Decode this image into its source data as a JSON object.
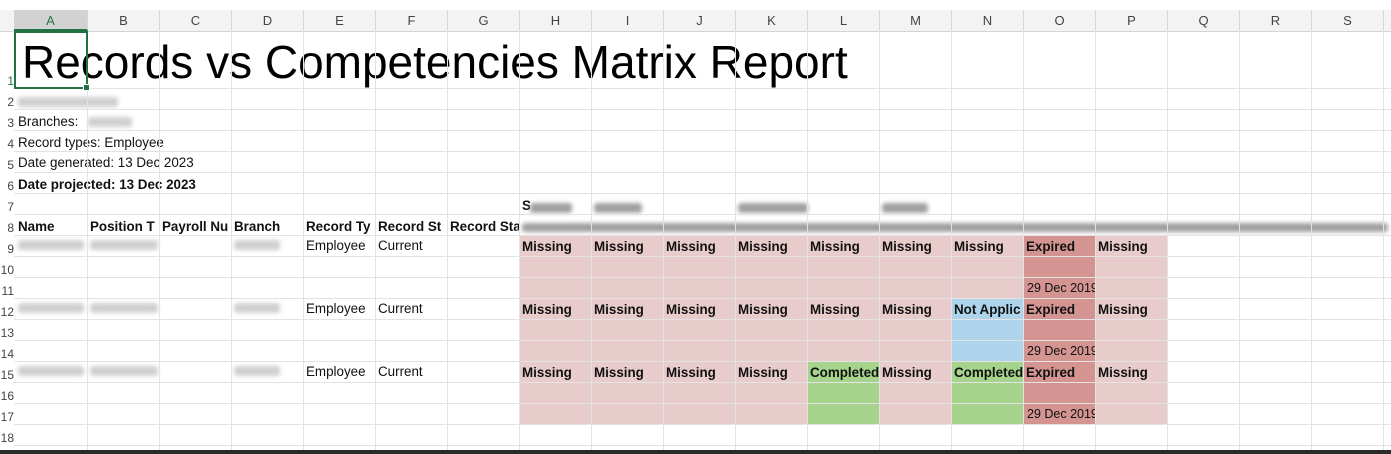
{
  "columns": [
    "A",
    "B",
    "C",
    "D",
    "E",
    "F",
    "G",
    "H",
    "I",
    "J",
    "K",
    "L",
    "M",
    "N",
    "O",
    "P",
    "Q",
    "R",
    "S"
  ],
  "selected_column": "A",
  "rows": [
    "1",
    "2",
    "3",
    "4",
    "5",
    "6",
    "7",
    "8",
    "9",
    "10",
    "11",
    "12",
    "13",
    "14",
    "15",
    "16",
    "17",
    "18"
  ],
  "report": {
    "title": "Records vs Competencies Matrix Report",
    "branches_label": "Branches:",
    "record_types": "Record types: Employee",
    "date_generated": "Date generated: 13 Dec 2023",
    "date_projected": "Date projected: 13 Dec 2023"
  },
  "headers": {
    "name": "Name",
    "position": "Position T",
    "payroll": "Payroll Nu",
    "branch": "Branch",
    "record_type": "Record Ty",
    "record_status": "Record St",
    "record_status2": "Record Sta",
    "competency_group_initial": "S"
  },
  "employees": [
    {
      "record_type": "Employee",
      "status": "Current",
      "cells": [
        "Missing",
        "Missing",
        "Missing",
        "Missing",
        "Missing",
        "Missing",
        "Missing",
        "Expired",
        "Missing"
      ],
      "expiry_date": "29 Dec 2019"
    },
    {
      "record_type": "Employee",
      "status": "Current",
      "cells": [
        "Missing",
        "Missing",
        "Missing",
        "Missing",
        "Missing",
        "Missing",
        "Not Applic",
        "Expired",
        "Missing"
      ],
      "expiry_date": "29 Dec 2019"
    },
    {
      "record_type": "Employee",
      "status": "Current",
      "cells": [
        "Missing",
        "Missing",
        "Missing",
        "Missing",
        "Completed",
        "Missing",
        "Completed",
        "Expired",
        "Missing"
      ],
      "expiry_date": "29 Dec 2019"
    }
  ],
  "colors": {
    "missing": "#e8cbcb",
    "expired": "#d49491",
    "completed": "#a6d48c",
    "not_applicable": "#aed4ec",
    "accent": "#217346"
  }
}
